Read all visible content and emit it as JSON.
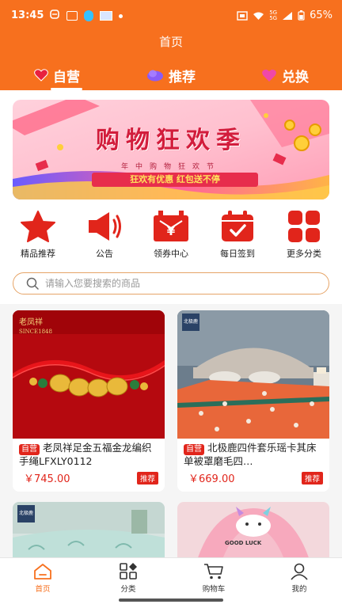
{
  "status": {
    "time": "13:45",
    "battery": "65%"
  },
  "page_title": "首页",
  "top_tabs": [
    {
      "label": "自营",
      "icon": "heart-icon"
    },
    {
      "label": "推荐",
      "icon": "cloud-icon"
    },
    {
      "label": "兑换",
      "icon": "heart-icon"
    }
  ],
  "banner": {
    "title": "购物狂欢季",
    "subtitle": "年中购物狂欢节",
    "ribbon": "狂欢有优惠 红包送不停"
  },
  "quick_links": [
    {
      "label": "精品推荐",
      "icon": "star-icon"
    },
    {
      "label": "公告",
      "icon": "megaphone-icon"
    },
    {
      "label": "领券中心",
      "icon": "coupon-icon"
    },
    {
      "label": "每日签到",
      "icon": "calendar-check-icon"
    },
    {
      "label": "更多分类",
      "icon": "grid-icon"
    }
  ],
  "search": {
    "placeholder": "请输入您要搜索的商品"
  },
  "products": [
    {
      "tag": "自营",
      "name": "老凤祥足金五福金龙编织手绳LFXLY0112",
      "price": "￥745.00",
      "badge": "推荐",
      "brand": "老凤祥",
      "brand_sub": "SINCE1848"
    },
    {
      "tag": "自营",
      "name": "北极鹿四件套乐瑶卡其床单被罩磨毛四…",
      "price": "￥669.00",
      "badge": "推荐",
      "brand": "北极鹿"
    },
    {
      "brand": "北极鹿"
    },
    {
      "print": "GOOD LUCK"
    }
  ],
  "tabbar": [
    {
      "label": "首页",
      "icon": "home-icon"
    },
    {
      "label": "分类",
      "icon": "category-icon"
    },
    {
      "label": "购物车",
      "icon": "cart-icon"
    },
    {
      "label": "我的",
      "icon": "user-icon"
    }
  ],
  "colors": {
    "brand": "#f7701e",
    "red": "#e1251b"
  }
}
